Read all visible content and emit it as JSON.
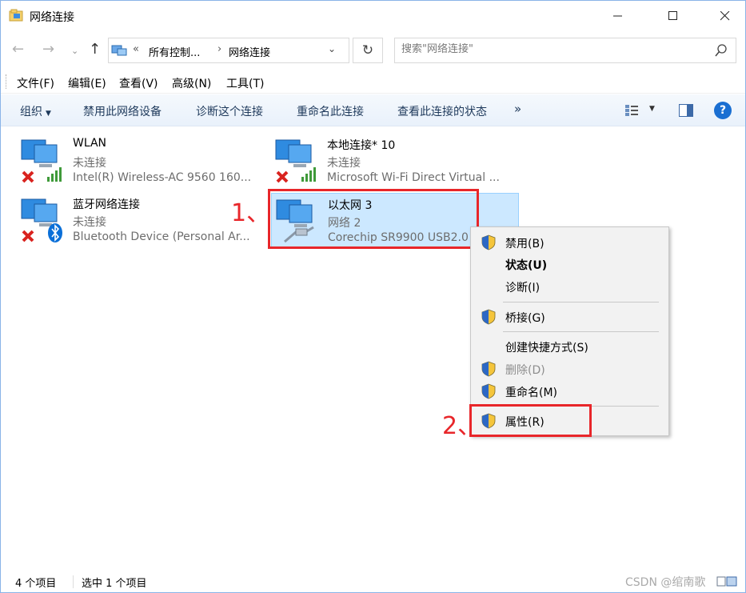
{
  "window": {
    "title": "网络连接"
  },
  "nav": {
    "back": "←",
    "forward": "→",
    "recent": "⌄",
    "up": "↑"
  },
  "address": {
    "prefix": "«",
    "crumb1": "所有控制...",
    "sep": "›",
    "crumb2": "网络连接",
    "dropdown": "⌄"
  },
  "refresh": "↻",
  "search": {
    "placeholder": "搜索\"网络连接\""
  },
  "menubar": {
    "file": "文件(F)",
    "edit": "编辑(E)",
    "view": "查看(V)",
    "advanced": "高级(N)",
    "tools": "工具(T)"
  },
  "commands": {
    "organize": "组织",
    "disable": "禁用此网络设备",
    "diagnose": "诊断这个连接",
    "rename": "重命名此连接",
    "status": "查看此连接的状态",
    "more": "»"
  },
  "connections": [
    {
      "name": "WLAN",
      "status": "未连接",
      "device": "Intel(R) Wireless-AC 9560 160..."
    },
    {
      "name": "本地连接* 10",
      "status": "未连接",
      "device": "Microsoft Wi-Fi Direct Virtual ..."
    },
    {
      "name": "蓝牙网络连接",
      "status": "未连接",
      "device": "Bluetooth Device (Personal Ar..."
    },
    {
      "name": "以太网 3",
      "status": "网络 2",
      "device": "Corechip SR9900 USB2.0"
    }
  ],
  "annotations": {
    "step1": "1、",
    "step2": "2、"
  },
  "context_menu": {
    "disable": "禁用(B)",
    "status": "状态(U)",
    "diagnose": "诊断(I)",
    "bridge": "桥接(G)",
    "shortcut": "创建快捷方式(S)",
    "delete": "删除(D)",
    "rename": "重命名(M)",
    "properties": "属性(R)"
  },
  "statusbar": {
    "count": "4 个项目",
    "selected": "选中 1 个项目",
    "watermark": "CSDN @绾南歌"
  },
  "colors": {
    "accent": "#1a6fd2",
    "selection": "#cce8ff",
    "annotation": "#e8262a"
  }
}
